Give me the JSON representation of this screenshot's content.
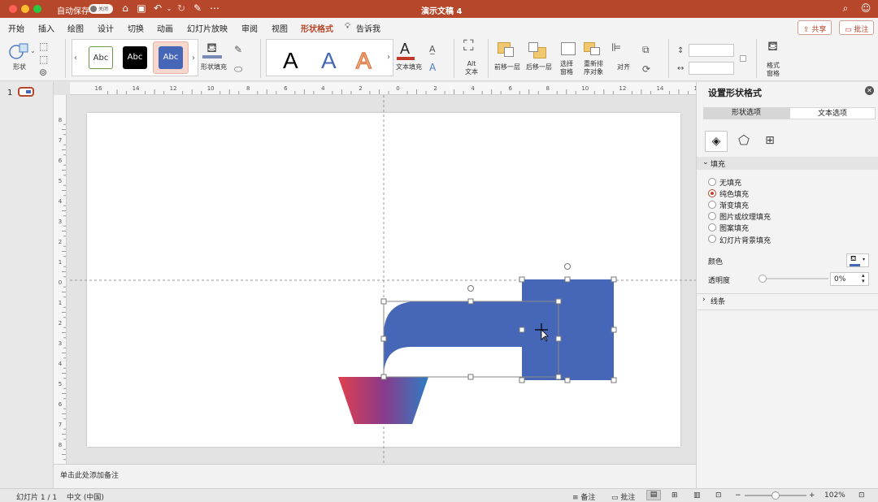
{
  "window": {
    "title": "演示文稿 4",
    "autosave_label": "自动保存",
    "autosave_state": "关闭"
  },
  "tabs": [
    "开始",
    "插入",
    "绘图",
    "设计",
    "切换",
    "动画",
    "幻灯片放映",
    "审阅",
    "视图",
    "形状格式",
    "告诉我"
  ],
  "active_tab": "形状格式",
  "top_buttons": {
    "share": "共享",
    "comment": "批注"
  },
  "ribbon": {
    "shape_label": "形状",
    "style_samples": [
      "Abc",
      "Abc",
      "Abc"
    ],
    "shape_fill_label": "形状填充",
    "wordart_letter": "A",
    "text_fill_label": "文本填充",
    "alt_text_label": "Alt 文本",
    "bring_forward_label": "前移一层",
    "send_backward_label": "后移一层",
    "selection_pane_label": "选择窗格",
    "reorder_label": "重新排序对象",
    "align_label": "对齐",
    "format_pane_label": "格式窗格"
  },
  "slides_pane": {
    "slide_number": "1"
  },
  "ruler_h": [
    "16",
    "14",
    "12",
    "10",
    "8",
    "6",
    "4",
    "2",
    "0",
    "2",
    "4",
    "6",
    "8",
    "10",
    "12",
    "14",
    "16"
  ],
  "ruler_v": [
    "8",
    "7",
    "6",
    "5",
    "4",
    "3",
    "2",
    "1",
    "0",
    "1",
    "2",
    "3",
    "4",
    "5",
    "6",
    "7",
    "8"
  ],
  "notes_placeholder": "单击此处添加备注",
  "format_pane": {
    "title": "设置形状格式",
    "tabs": [
      "形状选项",
      "文本选项"
    ],
    "fill_section": "填充",
    "fill_options": [
      "无填充",
      "纯色填充",
      "渐变填充",
      "图片或纹理填充",
      "图案填充",
      "幻灯片背景填充"
    ],
    "selected_fill": "纯色填充",
    "color_label": "颜色",
    "transparency_label": "透明度",
    "transparency_value": "0%",
    "line_section": "线条"
  },
  "status": {
    "slide_info": "幻灯片 1 / 1",
    "language": "中文 (中国)",
    "notes": "备注",
    "comments": "批注",
    "zoom": "102%"
  },
  "colors": {
    "accent": "#b7472a",
    "shape_blue": "#4667b8"
  }
}
